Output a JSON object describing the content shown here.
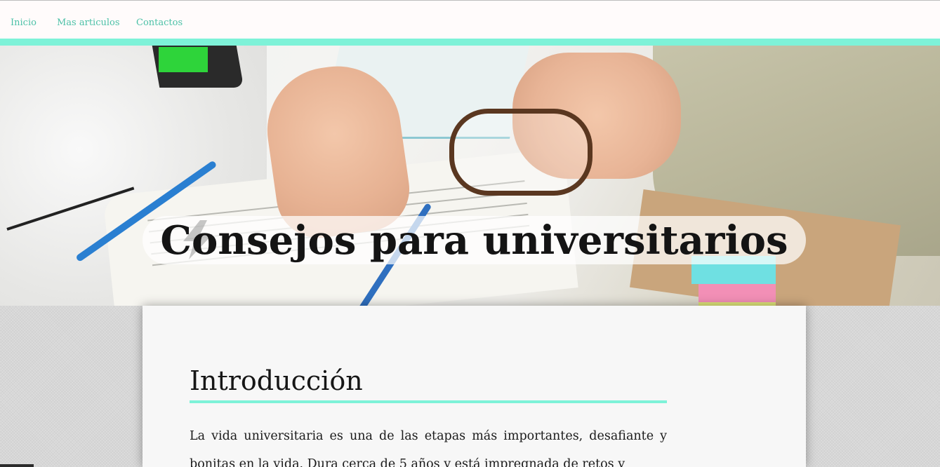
{
  "nav": {
    "items": [
      {
        "label": "Inicio"
      },
      {
        "label": "Mas articulos"
      },
      {
        "label": "Contactos"
      }
    ]
  },
  "hero": {
    "title": "Consejos para universitarios"
  },
  "article": {
    "heading": "Introducción",
    "paragraph": "La vida universitaria es una de las etapas más importantes, desafiante y bonitas en la vida. Dura cerca de 5 años y está impregnada de retos y"
  },
  "colors": {
    "accent": "#7ef2d8",
    "nav_link": "#4cc1a7",
    "nav_bg": "#fffbfb"
  }
}
